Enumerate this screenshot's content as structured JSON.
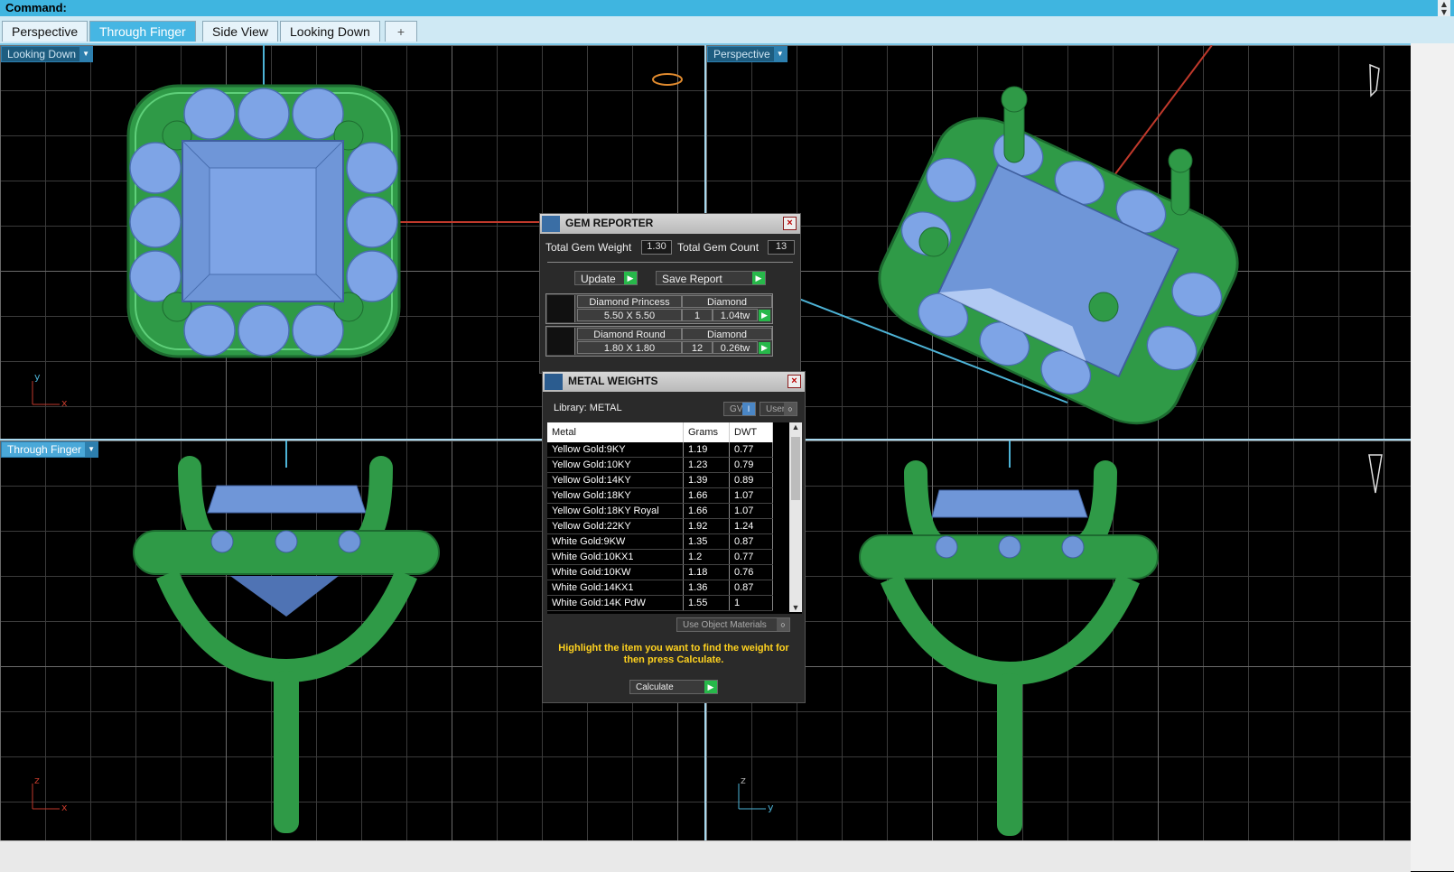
{
  "command": {
    "label": "Command:"
  },
  "tabs": [
    {
      "label": "Perspective"
    },
    {
      "label": "Through Finger"
    },
    {
      "label": "Side View"
    },
    {
      "label": "Looking Down"
    },
    {
      "label": "+"
    }
  ],
  "viewports": {
    "top_left": {
      "label": "Looking Down",
      "axis_v": "y",
      "axis_h": "x"
    },
    "top_right": {
      "label": "Perspective"
    },
    "bottom_left": {
      "label": "Through Finger",
      "axis_v": "z",
      "axis_h": "x"
    },
    "bottom_right": {
      "axis_v": "z",
      "axis_h": "y"
    }
  },
  "gem_reporter": {
    "title": "GEM REPORTER",
    "total_weight_label": "Total Gem Weight",
    "total_weight": "1.30",
    "total_count_label": "Total Gem Count",
    "total_count": "13",
    "update_label": "Update",
    "save_label": "Save Report",
    "gems": [
      {
        "shape": "Diamond Princess",
        "material": "Diamond",
        "size": "5.50 X 5.50",
        "count": "1",
        "weight": "1.04tw"
      },
      {
        "shape": "Diamond Round",
        "material": "Diamond",
        "size": "1.80 X 1.80",
        "count": "12",
        "weight": "0.26tw"
      }
    ]
  },
  "metal_weights": {
    "title": "METAL WEIGHTS",
    "library": "Library: METAL",
    "gv_label": "GV",
    "user_label": "User",
    "columns": [
      "Metal",
      "Grams",
      "DWT"
    ],
    "rows": [
      [
        "Yellow Gold:9KY",
        "1.19",
        "0.77"
      ],
      [
        "Yellow Gold:10KY",
        "1.23",
        "0.79"
      ],
      [
        "Yellow Gold:14KY",
        "1.39",
        "0.89"
      ],
      [
        "Yellow Gold:18KY",
        "1.66",
        "1.07"
      ],
      [
        "Yellow Gold:18KY Royal",
        "1.66",
        "1.07"
      ],
      [
        "Yellow Gold:22KY",
        "1.92",
        "1.24"
      ],
      [
        "White Gold:9KW",
        "1.35",
        "0.87"
      ],
      [
        "White Gold:10KX1",
        "1.2",
        "0.77"
      ],
      [
        "White Gold:10KW",
        "1.18",
        "0.76"
      ],
      [
        "White Gold:14KX1",
        "1.36",
        "0.87"
      ],
      [
        "White Gold:14K PdW",
        "1.55",
        "1"
      ]
    ],
    "use_object_materials": "Use Object Materials",
    "hint": "Highlight the item you want to find the weight for then press Calculate.",
    "calculate_label": "Calculate"
  },
  "colors": {
    "metal": "#2f9a47",
    "gem": "#6f96d8",
    "accent": "#46b6e3"
  }
}
